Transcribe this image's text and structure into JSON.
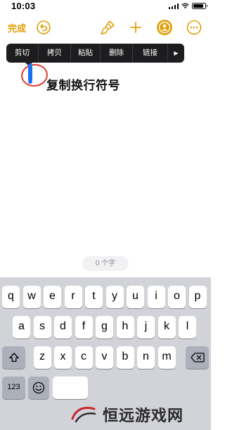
{
  "status_bar": {
    "time": "10:03",
    "battery_level": 0.9
  },
  "toolbar": {
    "done_label": "完成"
  },
  "context_menu": {
    "items": [
      "剪切",
      "拷贝",
      "粘贴",
      "删除",
      "链接"
    ],
    "more_arrow": "▶"
  },
  "annotation": {
    "text": "复制换行符号"
  },
  "word_count": "0 个字",
  "keyboard": {
    "row1": [
      "q",
      "w",
      "e",
      "r",
      "t",
      "y",
      "u",
      "i",
      "o",
      "p"
    ],
    "row2": [
      "a",
      "s",
      "d",
      "f",
      "g",
      "h",
      "j",
      "k",
      "l"
    ],
    "row3": [
      "z",
      "x",
      "c",
      "v",
      "b",
      "n",
      "m"
    ],
    "numbers_key": "123",
    "emoji_icon": "emoji-icon",
    "shift_icon": "shift-icon",
    "delete_icon": "backspace-icon"
  },
  "watermark": {
    "text": "恒远游戏网"
  },
  "colors": {
    "accent": "#e1a00c",
    "selection": "#1a6ff2",
    "annotation_circle": "#e23a2c"
  }
}
